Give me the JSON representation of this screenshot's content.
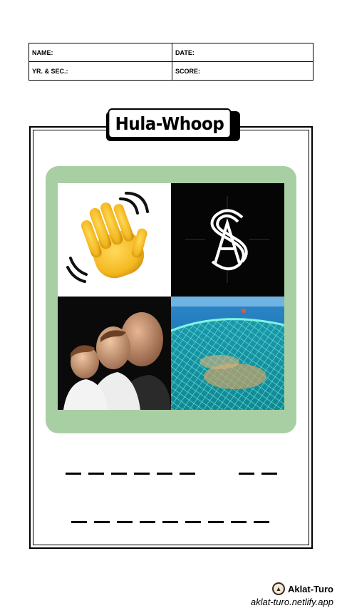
{
  "header": {
    "name_label": "NAME:",
    "date_label": "DATE:",
    "section_label": "YR. & SEC.:",
    "score_label": "SCORE:"
  },
  "title": "Hula-Whoop",
  "images": [
    {
      "icon": "waving-hand-icon"
    },
    {
      "icon": "monogram-logo-icon"
    },
    {
      "icon": "generations-photo"
    },
    {
      "icon": "fishing-net-photo"
    }
  ],
  "answer": {
    "row1_word1_letters": 6,
    "row1_word2_letters": 2,
    "row2_letters": 9
  },
  "footer": {
    "brand": "Aklat-Turo",
    "site": "aklat-turo.netlify.app"
  },
  "colors": {
    "panel": "#a8cfa3",
    "border": "#000000"
  }
}
